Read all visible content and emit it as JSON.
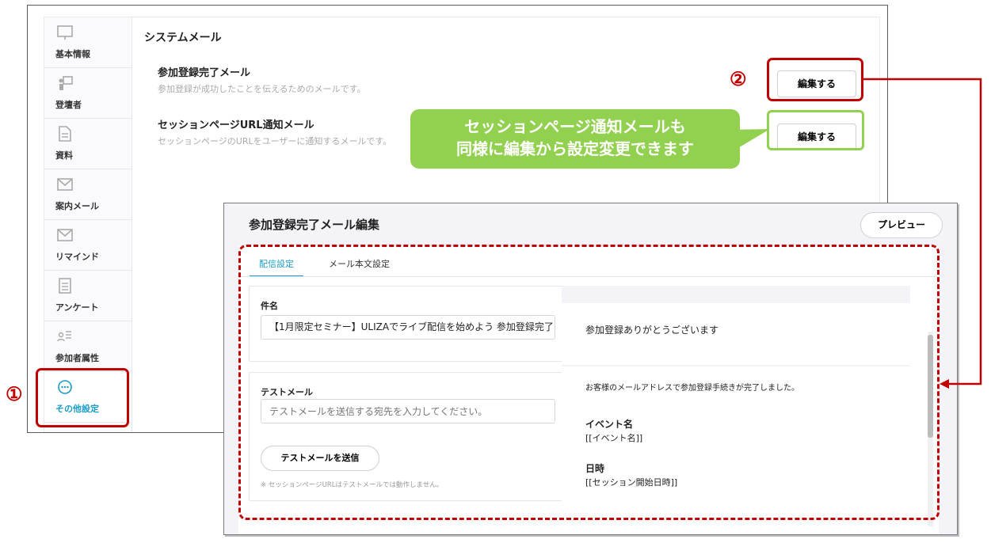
{
  "sidebar": {
    "items": [
      {
        "label": "基本情報",
        "icon": "monitor-icon"
      },
      {
        "label": "登壇者",
        "icon": "presenter-icon"
      },
      {
        "label": "資料",
        "icon": "document-icon"
      },
      {
        "label": "案内メール",
        "icon": "mail-icon"
      },
      {
        "label": "リマインド",
        "icon": "mail-icon"
      },
      {
        "label": "アンケート",
        "icon": "survey-icon"
      },
      {
        "label": "参加者属性",
        "icon": "attribute-icon"
      },
      {
        "label": "その他設定",
        "icon": "more-icon",
        "active": true
      }
    ]
  },
  "system_mail": {
    "title": "システムメール",
    "mails": [
      {
        "name": "参加登録完了メール",
        "desc": "参加登録が成功したことを伝えるためのメールです。",
        "button": "編集する"
      },
      {
        "name": "セッションページURL通知メール",
        "desc": "セッションページのURLをユーザーに通知するメールです。",
        "button": "編集する"
      }
    ]
  },
  "annotations": {
    "marker1": "①",
    "marker2": "②",
    "callout_line1": "セッションページ通知メールも",
    "callout_line2": "同様に編集から設定変更できます",
    "red": "#c00000",
    "green": "#92d050"
  },
  "editor": {
    "title": "参加登録完了メール編集",
    "preview_button": "プレビュー",
    "tabs": [
      "配信設定",
      "メール本文設定"
    ],
    "subject_label": "件名",
    "subject_value": "【1月限定セミナー】ULIZAでライブ配信を始めよう 参加登録完了",
    "test_label": "テストメール",
    "test_placeholder": "テストメールを送信する宛先を入力してください。",
    "send_button": "テストメールを送信",
    "note": "※ セッションページURLはテストメールでは動作しません。",
    "accent": "#1a9cc7"
  },
  "mail_preview": {
    "heading": "参加登録ありがとうございます",
    "intro": "お客様のメールアドレスで参加登録手続きが完了しました。",
    "event_label": "イベント名",
    "event_value": "[[イベント名]]",
    "date_label": "日時",
    "date_value": "[[セッション開始日時]]"
  }
}
